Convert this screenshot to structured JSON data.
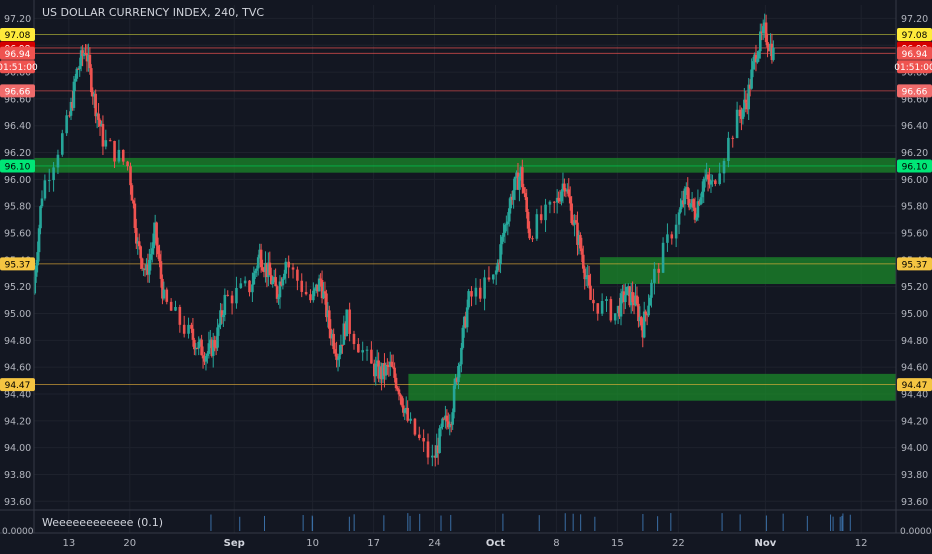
{
  "chart_title": "US DOLLAR CURRENCY INDEX, 240, TVC",
  "indicator_label": "Weeeeeeeeeeee (0.1)",
  "indicator_axis_label": "0.0000",
  "colors": {
    "background": "#131722",
    "up": "#26a69a",
    "down": "#ef5350",
    "zone": "#1b8a2a",
    "grid": "#1e222d",
    "text": "#b2b5be"
  },
  "chart_data": {
    "type": "candlestick",
    "title": "US DOLLAR CURRENCY INDEX, 240, TVC",
    "x_tick_labels": [
      "13",
      "20",
      "Sep",
      "10",
      "17",
      "24",
      "Oct",
      "8",
      "15",
      "22",
      "Nov",
      "12"
    ],
    "y_tick_labels": [
      "93.60",
      "93.80",
      "94.00",
      "94.20",
      "94.40",
      "94.60",
      "94.80",
      "95.00",
      "95.20",
      "95.40",
      "95.60",
      "95.80",
      "96.00",
      "96.20",
      "96.40",
      "96.60",
      "96.80",
      "97.00",
      "97.20"
    ],
    "ylim": [
      93.55,
      97.3
    ],
    "x_range": [
      "2018-08-09",
      "2018-11-16"
    ],
    "price_path": [
      [
        "2018-08-09",
        95.15
      ],
      [
        "2018-08-10",
        95.9
      ],
      [
        "2018-08-13",
        96.4
      ],
      [
        "2018-08-14",
        96.8
      ],
      [
        "2018-08-15",
        96.98
      ],
      [
        "2018-08-16",
        96.6
      ],
      [
        "2018-08-17",
        96.3
      ],
      [
        "2018-08-20",
        96.1
      ],
      [
        "2018-08-21",
        95.5
      ],
      [
        "2018-08-22",
        95.3
      ],
      [
        "2018-08-23",
        95.6
      ],
      [
        "2018-08-24",
        95.1
      ],
      [
        "2018-08-27",
        94.85
      ],
      [
        "2018-08-28",
        94.75
      ],
      [
        "2018-08-29",
        94.7
      ],
      [
        "2018-08-30",
        94.8
      ],
      [
        "2018-08-31",
        95.1
      ],
      [
        "2018-09-03",
        95.2
      ],
      [
        "2018-09-04",
        95.45
      ],
      [
        "2018-09-05",
        95.3
      ],
      [
        "2018-09-06",
        95.15
      ],
      [
        "2018-09-07",
        95.4
      ],
      [
        "2018-09-10",
        95.1
      ],
      [
        "2018-09-11",
        95.25
      ],
      [
        "2018-09-12",
        94.9
      ],
      [
        "2018-09-13",
        94.7
      ],
      [
        "2018-09-14",
        94.95
      ],
      [
        "2018-09-17",
        94.6
      ],
      [
        "2018-09-18",
        94.55
      ],
      [
        "2018-09-19",
        94.6
      ],
      [
        "2018-09-20",
        94.45
      ],
      [
        "2018-09-21",
        94.2
      ],
      [
        "2018-09-24",
        93.9
      ],
      [
        "2018-09-25",
        94.15
      ],
      [
        "2018-09-26",
        94.25
      ],
      [
        "2018-09-27",
        94.7
      ],
      [
        "2018-09-28",
        95.1
      ],
      [
        "2018-10-01",
        95.25
      ],
      [
        "2018-10-02",
        95.6
      ],
      [
        "2018-10-03",
        95.9
      ],
      [
        "2018-10-04",
        96.05
      ],
      [
        "2018-10-05",
        95.6
      ],
      [
        "2018-10-08",
        95.8
      ],
      [
        "2018-10-09",
        96.0
      ],
      [
        "2018-10-10",
        95.7
      ],
      [
        "2018-10-11",
        95.45
      ],
      [
        "2018-10-12",
        95.1
      ],
      [
        "2018-10-15",
        95.0
      ],
      [
        "2018-10-16",
        95.15
      ],
      [
        "2018-10-17",
        95.1
      ],
      [
        "2018-10-18",
        94.9
      ],
      [
        "2018-10-19",
        95.2
      ],
      [
        "2018-10-22",
        95.7
      ],
      [
        "2018-10-23",
        95.9
      ],
      [
        "2018-10-24",
        95.75
      ],
      [
        "2018-10-25",
        96.0
      ],
      [
        "2018-10-26",
        95.95
      ],
      [
        "2018-10-29",
        96.45
      ],
      [
        "2018-10-30",
        96.6
      ],
      [
        "2018-10-31",
        96.95
      ],
      [
        "2018-11-01",
        97.1
      ],
      [
        "2018-11-02",
        96.94
      ]
    ],
    "zones": [
      {
        "from": "2018-08-09",
        "to": "2018-11-16",
        "low": 96.05,
        "high": 96.16
      },
      {
        "from": "2018-10-13",
        "to": "2018-11-16",
        "low": 95.22,
        "high": 95.42
      },
      {
        "from": "2018-09-21",
        "to": "2018-11-16",
        "low": 94.35,
        "high": 94.55
      }
    ],
    "horizontal_lines": [
      {
        "value": 97.08,
        "color": "#c5c93a"
      },
      {
        "value": 96.98,
        "color": "#ef5350"
      },
      {
        "value": 96.94,
        "color": "#ef5350"
      },
      {
        "value": 96.66,
        "color": "#ef5350"
      },
      {
        "value": 96.1,
        "color": "#00c853"
      },
      {
        "value": 95.37,
        "color": "#f0b53a"
      },
      {
        "value": 94.47,
        "color": "#f0b53a"
      }
    ],
    "price_labels": [
      {
        "text": "97.08",
        "value": 97.08,
        "bg": "#ffeb3b",
        "fg": "#000000"
      },
      {
        "text": "96.98",
        "value": 96.98,
        "bg": "#d50000",
        "fg": "#ffffff"
      },
      {
        "text": "96.94",
        "value": 96.94,
        "bg": "#ef5350",
        "fg": "#ffffff"
      },
      {
        "text": "01:51:00",
        "value": 96.84,
        "bg": "#ef5350",
        "fg": "#ffffff"
      },
      {
        "text": "96.66",
        "value": 96.66,
        "bg": "#f06b6b",
        "fg": "#ffffff"
      },
      {
        "text": "96.10",
        "value": 96.1,
        "bg": "#00e676",
        "fg": "#000000"
      },
      {
        "text": "95.37",
        "value": 95.37,
        "bg": "#f5c542",
        "fg": "#000000"
      },
      {
        "text": "94.47",
        "value": 94.47,
        "bg": "#f5c542",
        "fg": "#000000"
      }
    ]
  }
}
